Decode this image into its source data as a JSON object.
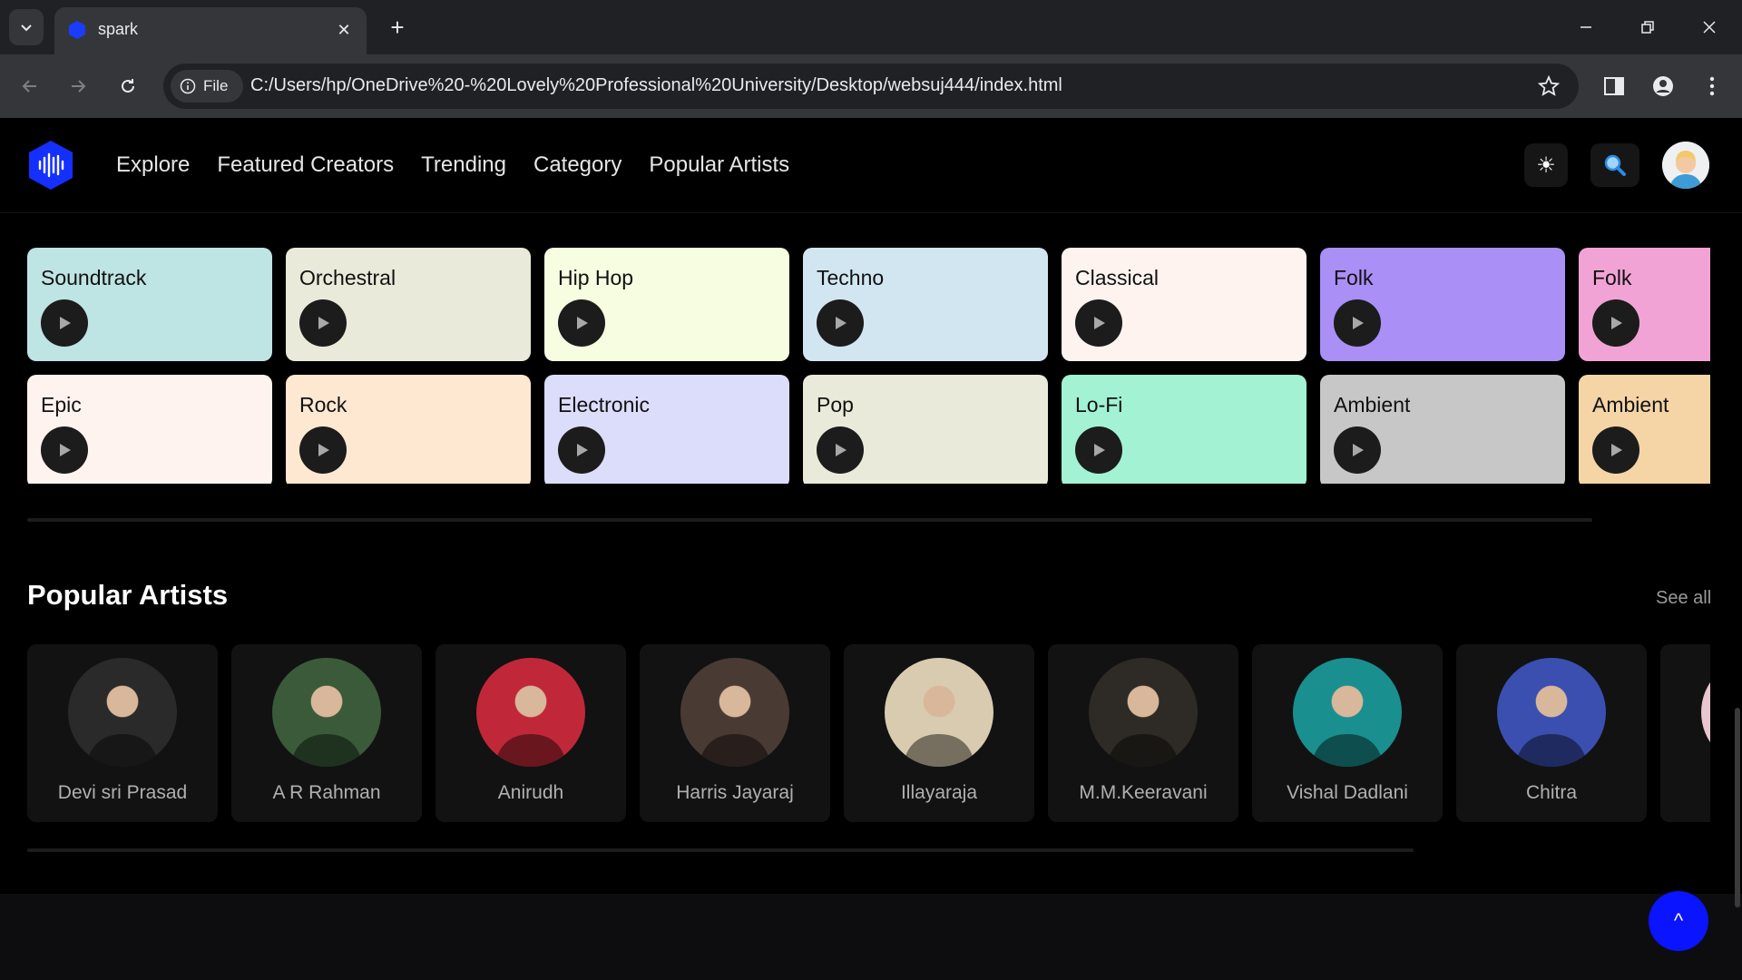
{
  "browser": {
    "tab_title": "spark",
    "file_label": "File",
    "url": "C:/Users/hp/OneDrive%20-%20Lovely%20Professional%20University/Desktop/websuj444/index.html"
  },
  "nav": {
    "links": [
      "Explore",
      "Featured Creators",
      "Trending",
      "Category",
      "Popular Artists"
    ],
    "theme_icon": "☀",
    "search_icon": "🔍"
  },
  "categories": [
    {
      "label": "Soundtrack",
      "color": "#bfe4e4"
    },
    {
      "label": "Orchestral",
      "color": "#e9ead9"
    },
    {
      "label": "Hip Hop",
      "color": "#f6fde0"
    },
    {
      "label": "Techno",
      "color": "#d2e6f2"
    },
    {
      "label": "Classical",
      "color": "#fff3f0"
    },
    {
      "label": "Folk",
      "color": "#a98ff6"
    },
    {
      "label": "Folk",
      "color": "#f2a3d6"
    },
    {
      "label": "Epic",
      "color": "#fff3f0"
    },
    {
      "label": "Rock",
      "color": "#ffe8d2"
    },
    {
      "label": "Electronic",
      "color": "#dcdcfb"
    },
    {
      "label": "Pop",
      "color": "#e9ead9"
    },
    {
      "label": "Lo-Fi",
      "color": "#a2f2d3"
    },
    {
      "label": "Ambient",
      "color": "#c7c7c7"
    },
    {
      "label": "Ambient",
      "color": "#f5d4a6"
    }
  ],
  "popular_artists": {
    "title": "Popular Artists",
    "see_all": "See all",
    "artists": [
      {
        "name": "Devi sri Prasad",
        "tone": "#2a2a2a"
      },
      {
        "name": "A R Rahman",
        "tone": "#3a5a3a"
      },
      {
        "name": "Anirudh",
        "tone": "#c0283a"
      },
      {
        "name": "Harris Jayaraj",
        "tone": "#4a3a34"
      },
      {
        "name": "Illayaraja",
        "tone": "#d8cbb0"
      },
      {
        "name": "M.M.Keeravani",
        "tone": "#2e2a26"
      },
      {
        "name": "Vishal Dadlani",
        "tone": "#1a8f8f"
      },
      {
        "name": "Chitra",
        "tone": "#3a4fb0"
      },
      {
        "name": "",
        "tone": "#e7c6cf"
      }
    ]
  },
  "scroll_top_label": "^"
}
